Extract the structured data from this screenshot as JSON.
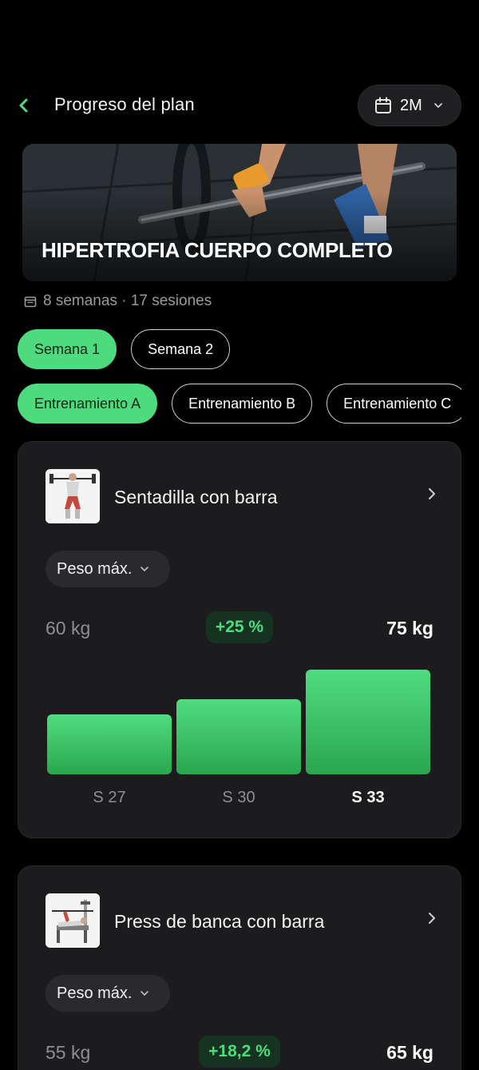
{
  "header": {
    "title": "Progreso del plan",
    "range_value": "2M"
  },
  "plan": {
    "name": "HIPERTROFIA CUERPO COMPLETO",
    "meta": "8 semanas · 17 sesiones"
  },
  "weeks": [
    {
      "label": "Semana 1",
      "active": true
    },
    {
      "label": "Semana 2",
      "active": false
    }
  ],
  "workouts": [
    {
      "label": "Entrenamiento A",
      "active": true
    },
    {
      "label": "Entrenamiento B",
      "active": false
    },
    {
      "label": "Entrenamiento C",
      "active": false
    }
  ],
  "exercises": [
    {
      "name": "Sentadilla con barra",
      "metric": "Peso máx.",
      "from": "60 kg",
      "change": "+25 %",
      "to": "75 kg",
      "bars": [
        {
          "label": "S 27",
          "value": 60,
          "current": false
        },
        {
          "label": "S 30",
          "value": 65,
          "current": false
        },
        {
          "label": "S 33",
          "value": 75,
          "current": true
        }
      ]
    },
    {
      "name": "Press de banca con barra",
      "metric": "Peso máx.",
      "from": "55 kg",
      "change": "+18,2 %",
      "to": "65 kg"
    }
  ],
  "colors": {
    "accent": "#4ddb7d",
    "card": "#1c1c1f",
    "background": "#000000"
  },
  "icons": {
    "back": "chevron-left-icon",
    "calendar": "calendar-icon",
    "dropdown": "chevron-down-icon",
    "detail": "chevron-right-icon"
  }
}
